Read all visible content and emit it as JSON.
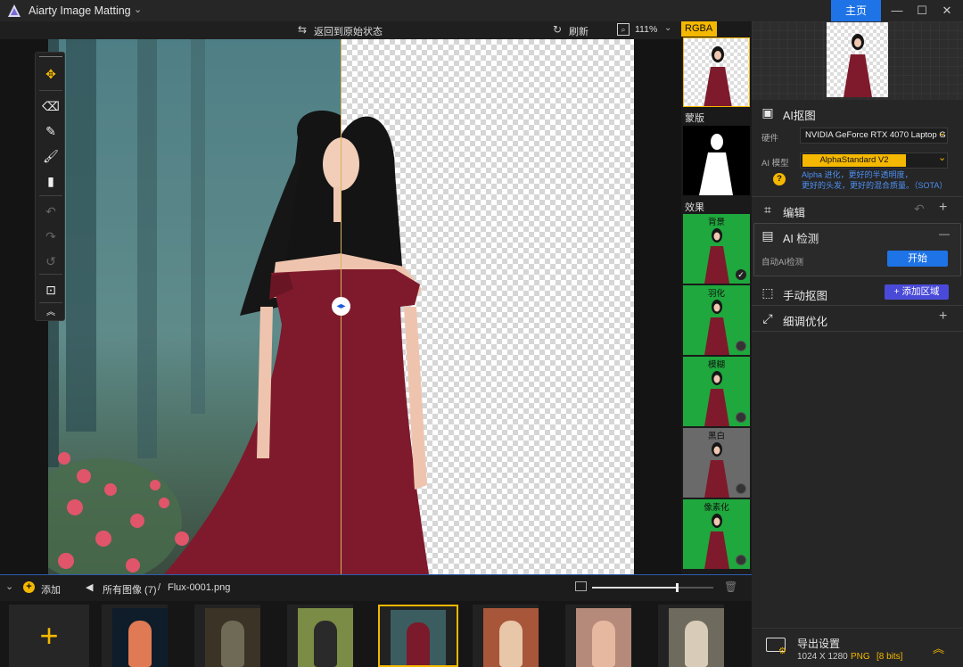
{
  "app": {
    "title": "Aiarty Image Matting",
    "home_label": "主页",
    "title_chevron": "⌄",
    "window_controls": {
      "minimize": "—",
      "maximize": "☐",
      "close": "✕"
    }
  },
  "canvas_toolbar": {
    "reset_label": "返回到原始状态",
    "refresh_label": "刷新",
    "zoom": "111%"
  },
  "tools": [
    {
      "name": "move-tool-icon",
      "glyph": "✥",
      "active": true
    },
    {
      "name": "eraser-icon",
      "glyph": "⌫"
    },
    {
      "name": "pen-icon",
      "glyph": "✎"
    },
    {
      "name": "brush-icon",
      "glyph": "🖌"
    },
    {
      "name": "roller-icon",
      "glyph": "▮"
    },
    {
      "name": "undo-icon",
      "glyph": "↶"
    },
    {
      "name": "redo-icon",
      "glyph": "↷"
    },
    {
      "name": "reset-icon",
      "glyph": "↺"
    },
    {
      "name": "fit-screen-icon",
      "glyph": "⊡"
    },
    {
      "name": "collapse-icon",
      "glyph": "︽"
    }
  ],
  "strip": {
    "rgba_label": "RGBA",
    "mask_label": "蒙版",
    "effects_label": "效果",
    "effects": [
      {
        "label": "背景",
        "selected": true,
        "bg": "#1fa83d"
      },
      {
        "label": "羽化",
        "selected": false,
        "bg": "#1fa83d"
      },
      {
        "label": "模糊",
        "selected": false,
        "bg": "#1fa83d"
      },
      {
        "label": "黑白",
        "selected": false,
        "bg": "#6a6a6a"
      },
      {
        "label": "像素化",
        "selected": false,
        "bg": "#1fa83d"
      }
    ],
    "check_glyph": "✓"
  },
  "right_panel": {
    "ai_matting": {
      "title": "AI抠图",
      "hardware_label": "硬件",
      "hardware_value": "NVIDIA GeForce RTX 4070 Laptop G",
      "model_label": "AI 模型",
      "model_value": "AlphaStandard  V2",
      "hint_line1": "Alpha 进化，更好的半透明度，",
      "hint_line2": "更好的头发，更好的混合质量。（SOTA）",
      "help": "?"
    },
    "edit": {
      "title": "编辑",
      "undo": "↶",
      "add": "+"
    },
    "ai_detect": {
      "title": "AI 检测",
      "collapse": "—",
      "auto_label": "自动AI检测",
      "start_label": "开始"
    },
    "manual": {
      "title": "手动抠图",
      "add_region_label": "+ 添加区域"
    },
    "refine": {
      "title": "细调优化",
      "add": "+"
    },
    "export": {
      "title": "导出设置",
      "size": "1024 X 1280",
      "format": "PNG",
      "bits": "[8 bits]",
      "expand": "︽"
    }
  },
  "bottom": {
    "collapse_glyph": "⌄",
    "add_label": "添加",
    "back_glyph": "🡐",
    "breadcrumb_all": "所有图像 (7)",
    "breadcrumb_sep": "/",
    "breadcrumb_file": "Flux-0001.png",
    "zoom_slider_value": 0.7,
    "plus_glyph": "+"
  },
  "gallery": [
    {
      "name": "jellyfish",
      "bg": "#0f1d2a",
      "fg": "#e07a55"
    },
    {
      "name": "forest-rocks",
      "bg": "#3a3326",
      "fg": "#6f6a55"
    },
    {
      "name": "bicycle",
      "bg": "#7a8c45",
      "fg": "#2a2a2a"
    },
    {
      "name": "red-dress-girl",
      "bg": "#3b5d60",
      "fg": "#7a1a2a",
      "selected": true
    },
    {
      "name": "girl-with-flowers",
      "bg": "#a8563a",
      "fg": "#e8c6a8"
    },
    {
      "name": "girl-roses",
      "bg": "#b58a7a",
      "fg": "#e6b8a0"
    },
    {
      "name": "girl-white-dress",
      "bg": "#6e6a5e",
      "fg": "#d8ccb8"
    }
  ],
  "colors": {
    "accent": "#1e73e6",
    "gold": "#f5b800",
    "green": "#1fa83d"
  }
}
